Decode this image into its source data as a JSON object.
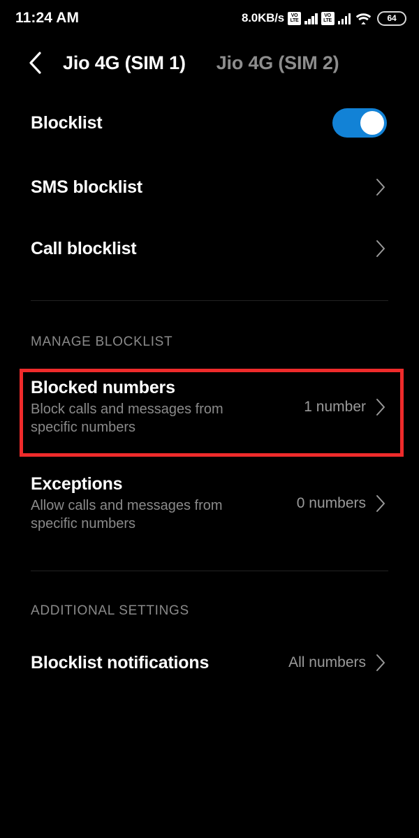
{
  "status_bar": {
    "time": "11:24 AM",
    "network_speed": "8.0KB/s",
    "sim1_volte_top": "VO",
    "sim1_volte_bottom": "LTE",
    "sim2_volte_top": "VO",
    "sim2_volte_bottom": "LTE",
    "battery_percent": "64"
  },
  "header": {
    "back_icon": "chevron-left-icon",
    "tabs": [
      {
        "label": "Jio 4G (SIM 1)",
        "active": true
      },
      {
        "label": "Jio 4G (SIM 2)",
        "active": false
      }
    ]
  },
  "blocklist_toggle": {
    "label": "Blocklist",
    "enabled": true
  },
  "top_rows": [
    {
      "title": "SMS blocklist"
    },
    {
      "title": "Call blocklist"
    }
  ],
  "manage_section": {
    "title": "MANAGE BLOCKLIST",
    "rows": [
      {
        "title": "Blocked numbers",
        "subtitle": "Block calls and messages from specific numbers",
        "value": "1 number",
        "highlighted": true
      },
      {
        "title": "Exceptions",
        "subtitle": "Allow calls and messages from specific numbers",
        "value": "0 numbers",
        "highlighted": false
      }
    ]
  },
  "additional_section": {
    "title": "ADDITIONAL SETTINGS",
    "rows": [
      {
        "title": "Blocklist notifications",
        "value": "All numbers"
      }
    ]
  },
  "colors": {
    "background": "#000000",
    "toggle_on": "#1282d6",
    "highlight_border": "#ef2b2b",
    "primary_text": "#ffffff",
    "secondary_text": "#8a8a8a",
    "divider": "#232323"
  }
}
